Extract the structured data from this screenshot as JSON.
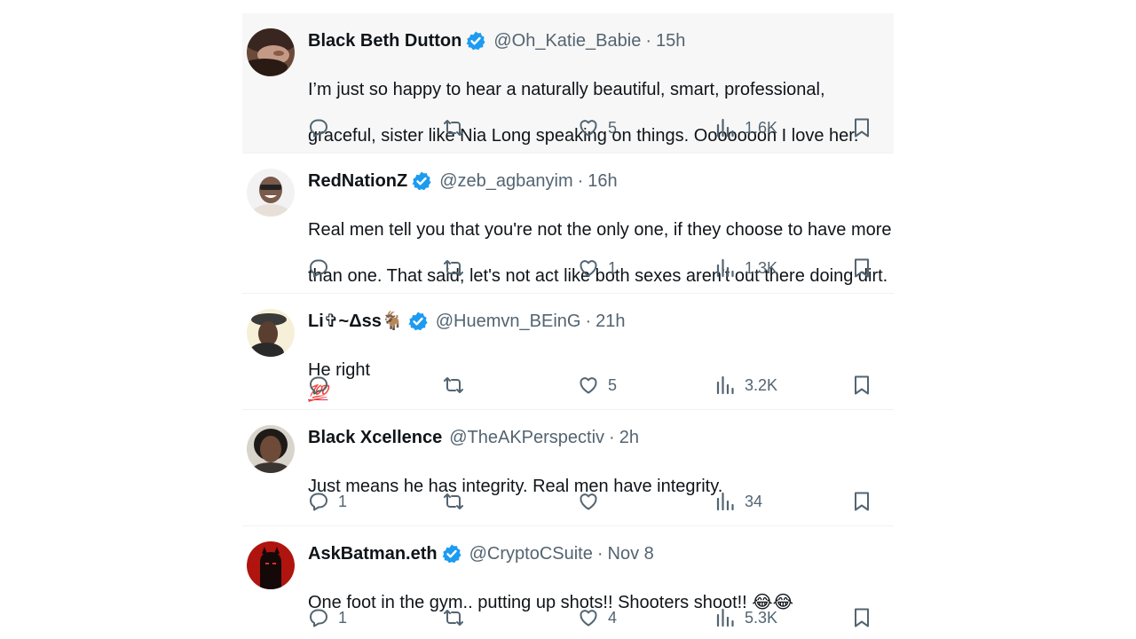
{
  "tweets": [
    {
      "name": "Black Beth Dutton",
      "verified": true,
      "handle": "@Oh_Katie_Babie",
      "dot": "·",
      "time": "15h",
      "text_lines": [
        "I’m just so happy to hear a naturally beautiful, smart, professional,",
        "graceful, sister like Nia Long speaking on things. Oooooooh I love her."
      ],
      "replies": "",
      "likes": "5",
      "views": "1.6K"
    },
    {
      "name": "RedNationZ",
      "verified": true,
      "handle": "@zeb_agbanyim",
      "dot": "·",
      "time": "16h",
      "text_lines": [
        "Real men tell you that you're not the only one, if they choose to have more",
        "than one. That said, let's not act like both sexes aren't out there doing dirt."
      ],
      "replies": "",
      "likes": "1",
      "views": "1.3K"
    },
    {
      "name": "Li✞~Δss🐐",
      "verified": true,
      "handle": "@Huemvn_BEinG",
      "dot": "·",
      "time": "21h",
      "text": "He right",
      "emoji": "💯",
      "replies": "",
      "likes": "5",
      "views": "3.2K"
    },
    {
      "name": "Black Xcellence",
      "verified": false,
      "handle": "@TheAKPerspectiv",
      "dot": "·",
      "time": "2h",
      "text": "Just means he has integrity. Real men have integrity.",
      "replies": "1",
      "likes": "",
      "views": "34"
    },
    {
      "name": "AskBatman.eth",
      "verified": true,
      "handle": "@CryptoCSuite",
      "dot": "·",
      "time": "Nov 8",
      "text": "One foot in the gym..  putting up shots!!  Shooters shoot!! 😂😂",
      "replies": "1",
      "likes": "4",
      "views": "5.3K"
    }
  ],
  "colors": {
    "accent": "#1d9bf0",
    "muted": "#536471",
    "text": "#0f1419",
    "highlight_bg": "#f7f7f7",
    "divider": "#eff3f4"
  },
  "icons": {
    "reply": "reply-icon",
    "retweet": "retweet-icon",
    "like": "heart-icon",
    "views": "views-icon",
    "bookmark": "bookmark-icon",
    "verified": "verified-badge-icon"
  }
}
